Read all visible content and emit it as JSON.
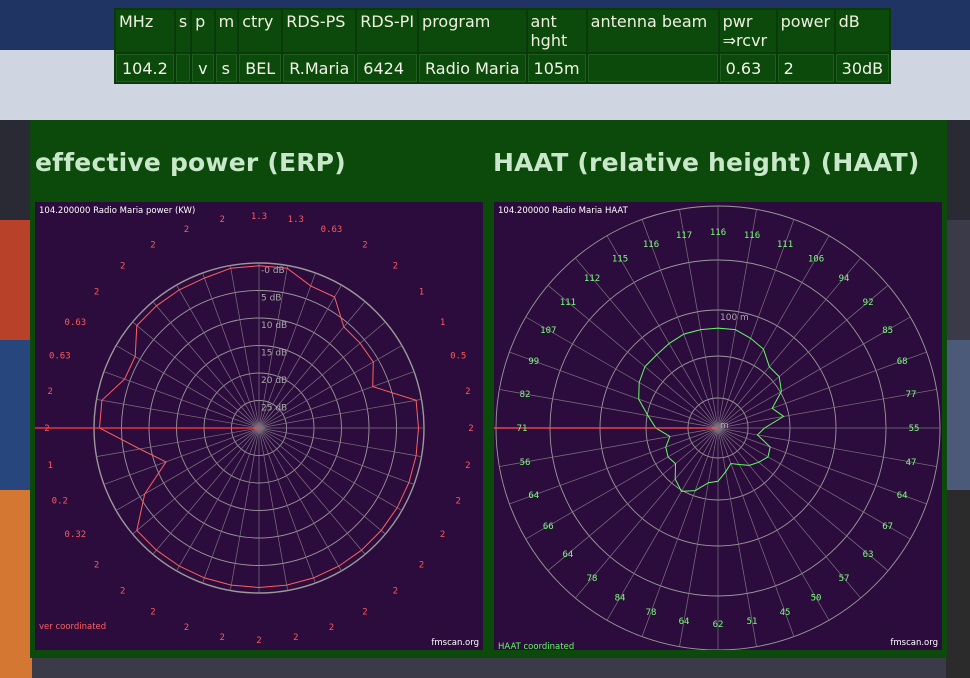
{
  "table": {
    "headers": [
      "MHz",
      "s",
      "p",
      "m",
      "ctry",
      "RDS-PS",
      "RDS-PI",
      "program",
      "ant\nhght",
      "antenna beam",
      "pwr\n⇒rcvr",
      "power",
      "dB"
    ],
    "row": [
      "104.2",
      "",
      "v",
      "s",
      "BEL",
      "R.Maria",
      "6424",
      "Radio Maria",
      "105m",
      "",
      "0.63",
      "2",
      "30dB"
    ]
  },
  "headings": {
    "erp": "effective power (ERP)",
    "haat": "HAAT (relative height) (HAAT)"
  },
  "colors": {
    "panel_bg": "#0b4a0b",
    "chart_bg": "#2c0c3c",
    "erp_color": "#ff6060",
    "haat_color": "#60ff60",
    "grid": "#8a8a8a"
  },
  "chart_data": [
    {
      "type": "polar",
      "title": "104.200000 Radio Maria power (KW)",
      "watermark": "fmscan.org",
      "footer": "ver coordinated",
      "ring_labels": [
        "-0 dB",
        "5 dB",
        "10 dB",
        "15 dB",
        "20 dB",
        "25 dB"
      ],
      "azimuth_step_deg": 10,
      "direction_labels": [
        "1.3",
        "1.3",
        "0.63",
        "2",
        "2",
        "1",
        "1",
        "0.5",
        "2",
        "2",
        "2",
        "2",
        "2",
        "2",
        "2",
        "2",
        "2",
        "2",
        "2",
        "2",
        "2",
        "2",
        "2",
        "2",
        "0.32",
        "0.2",
        "1",
        "2",
        "2",
        "0.63",
        "0.63",
        "2",
        "2",
        "2",
        "2",
        "2"
      ],
      "pattern_db": [
        0.5,
        0.5,
        2.5,
        2.5,
        6,
        6,
        6,
        8,
        1,
        1,
        1,
        1,
        1,
        1,
        1,
        1,
        1,
        1,
        1,
        1,
        1,
        1,
        1,
        1,
        6,
        12,
        8,
        1,
        1,
        4,
        4,
        1,
        1,
        1,
        1,
        0.5
      ],
      "pointer_azimuth_deg": 270
    },
    {
      "type": "polar",
      "title": "104.200000 Radio Maria HAAT",
      "watermark": "fmscan.org",
      "footer": "HAAT coordinated",
      "ring_labels": [
        "100 m",
        "m"
      ],
      "azimuth_step_deg": 10,
      "direction_labels": [
        "116",
        "116",
        "111",
        "106",
        "94",
        "92",
        "85",
        "68",
        "77",
        "55",
        "47",
        "64",
        "67",
        "63",
        "57",
        "50",
        "45",
        "51",
        "62",
        "64",
        "78",
        "84",
        "78",
        "64",
        "66",
        "64",
        "56",
        "71",
        "82",
        "99",
        "107",
        "111",
        "112",
        "115",
        "116",
        "117"
      ],
      "pattern_radius_frac": [
        0.45,
        0.45,
        0.43,
        0.41,
        0.36,
        0.36,
        0.33,
        0.26,
        0.3,
        0.21,
        0.18,
        0.25,
        0.26,
        0.24,
        0.22,
        0.19,
        0.17,
        0.2,
        0.24,
        0.25,
        0.3,
        0.33,
        0.3,
        0.25,
        0.26,
        0.25,
        0.22,
        0.28,
        0.32,
        0.38,
        0.41,
        0.43,
        0.43,
        0.44,
        0.45,
        0.45
      ],
      "pointer_azimuth_deg": 270
    }
  ]
}
